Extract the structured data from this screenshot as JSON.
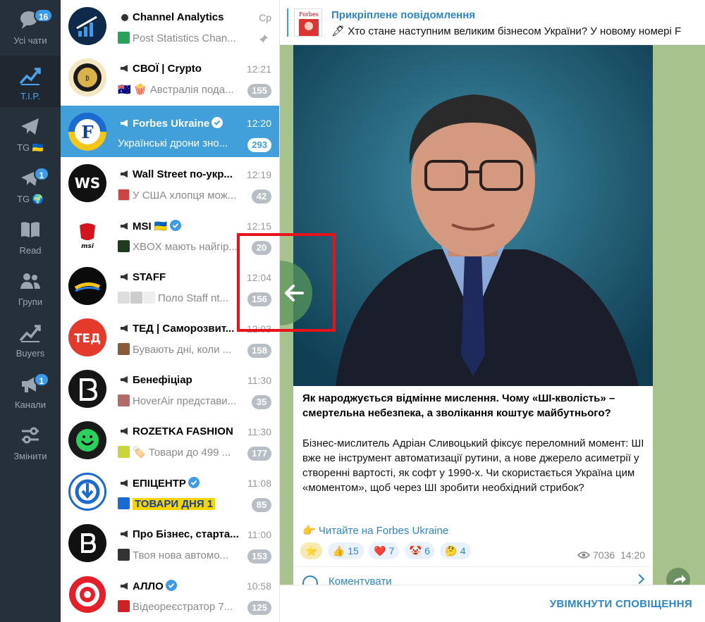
{
  "folders": [
    {
      "label": "Усі чати",
      "badge": "16",
      "icon": "chats-icon"
    },
    {
      "label": "T.I.P.",
      "badge": "",
      "icon": "chart-icon",
      "active": true
    },
    {
      "label": "TG 🇺🇦",
      "badge": "",
      "icon": "telegram-icon"
    },
    {
      "label": "TG 🌍",
      "badge": "1",
      "icon": "telegram-icon"
    },
    {
      "label": "Read",
      "badge": "",
      "icon": "book-icon"
    },
    {
      "label": "Групи",
      "badge": "",
      "icon": "group-icon"
    },
    {
      "label": "Buyers",
      "badge": "",
      "icon": "chart-icon"
    },
    {
      "label": "Канали",
      "badge": "1",
      "icon": "megaphone-icon"
    },
    {
      "label": "Змінити",
      "badge": "",
      "icon": "edit-icon"
    }
  ],
  "chats": [
    {
      "name": "Channel Analytics",
      "time": "Ср",
      "preview": "Post Statistics  Chan...",
      "badge": "",
      "pinned": true
    },
    {
      "name": "СВОЇ | Crypto",
      "time": "12:21",
      "preview": "🇦🇺 🍿 Австралія пода...",
      "badge": "155"
    },
    {
      "name": "Forbes Ukraine",
      "time": "12:20",
      "preview": "Українські дрони зно...",
      "badge": "293",
      "selected": true
    },
    {
      "name": "Wall Street по-укр...",
      "time": "12:19",
      "preview": "У США хлопця мож...",
      "badge": "42"
    },
    {
      "name": "MSI 🇺🇦",
      "time": "12:15",
      "preview": "XBOX мають найгір...",
      "badge": "20"
    },
    {
      "name": "STAFF",
      "time": "12:04",
      "preview": "Поло Staff nt...",
      "badge": "156"
    },
    {
      "name": "ТЕД | Саморозвит...",
      "time": "12:03",
      "preview": "Бувають дні, коли ...",
      "badge": "158"
    },
    {
      "name": "Бенефіціар",
      "time": "11:30",
      "preview": "HoverAir представи...",
      "badge": "35"
    },
    {
      "name": "ROZETKA FASHION",
      "time": "11:30",
      "preview": "🏷️ Товари до 499 ...",
      "badge": "177"
    },
    {
      "name": "ЕПІЦЕНТР",
      "time": "11:08",
      "preview": "ТОВАРИ ДНЯ  1",
      "badge": "85"
    },
    {
      "name": "Про Бізнес, старта...",
      "time": "11:00",
      "preview": "Твоя нова автомо...",
      "badge": "153"
    },
    {
      "name": "АЛЛО",
      "time": "10:58",
      "preview": "Відеореєстратор 7...",
      "badge": "125"
    }
  ],
  "pinned": {
    "title": "Прикріплене повідомлення",
    "text": "🖋 Хто стане наступним великим бізнесом України?  У новому номері F"
  },
  "post": {
    "title": "Як народжується відмінне мислення. Чому «ШІ-кволість» – смертельна небезпека, а зволікання коштує майбутнього?",
    "body": "Бізнес-мислитель Адріан Сливоцький фіксує переломний момент: ШІ вже не інструмент автоматизації рутини, а нове джерело асиметрії у створенні вартості, як софт у 1990-х. Чи скористається Україна цим «моментом», щоб через ШІ зробити необхідний стрибок?",
    "link": "👉 Читайте на Forbes Ukraine",
    "reactions": [
      {
        "emoji": "⭐",
        "count": ""
      },
      {
        "emoji": "👍",
        "count": "15"
      },
      {
        "emoji": "❤️",
        "count": "7"
      },
      {
        "emoji": "🤡",
        "count": "6"
      },
      {
        "emoji": "🤔",
        "count": "4"
      }
    ],
    "views": "7036",
    "time": "14:20",
    "comments_label": "Коментувати"
  },
  "bottom": {
    "notify_label": "УВІМКНУТИ СПОВІЩЕННЯ"
  },
  "colors": {
    "accent": "#419fd9",
    "rail": "#26303b",
    "link": "#2e86c9",
    "highlight_box": "#e8121a"
  }
}
